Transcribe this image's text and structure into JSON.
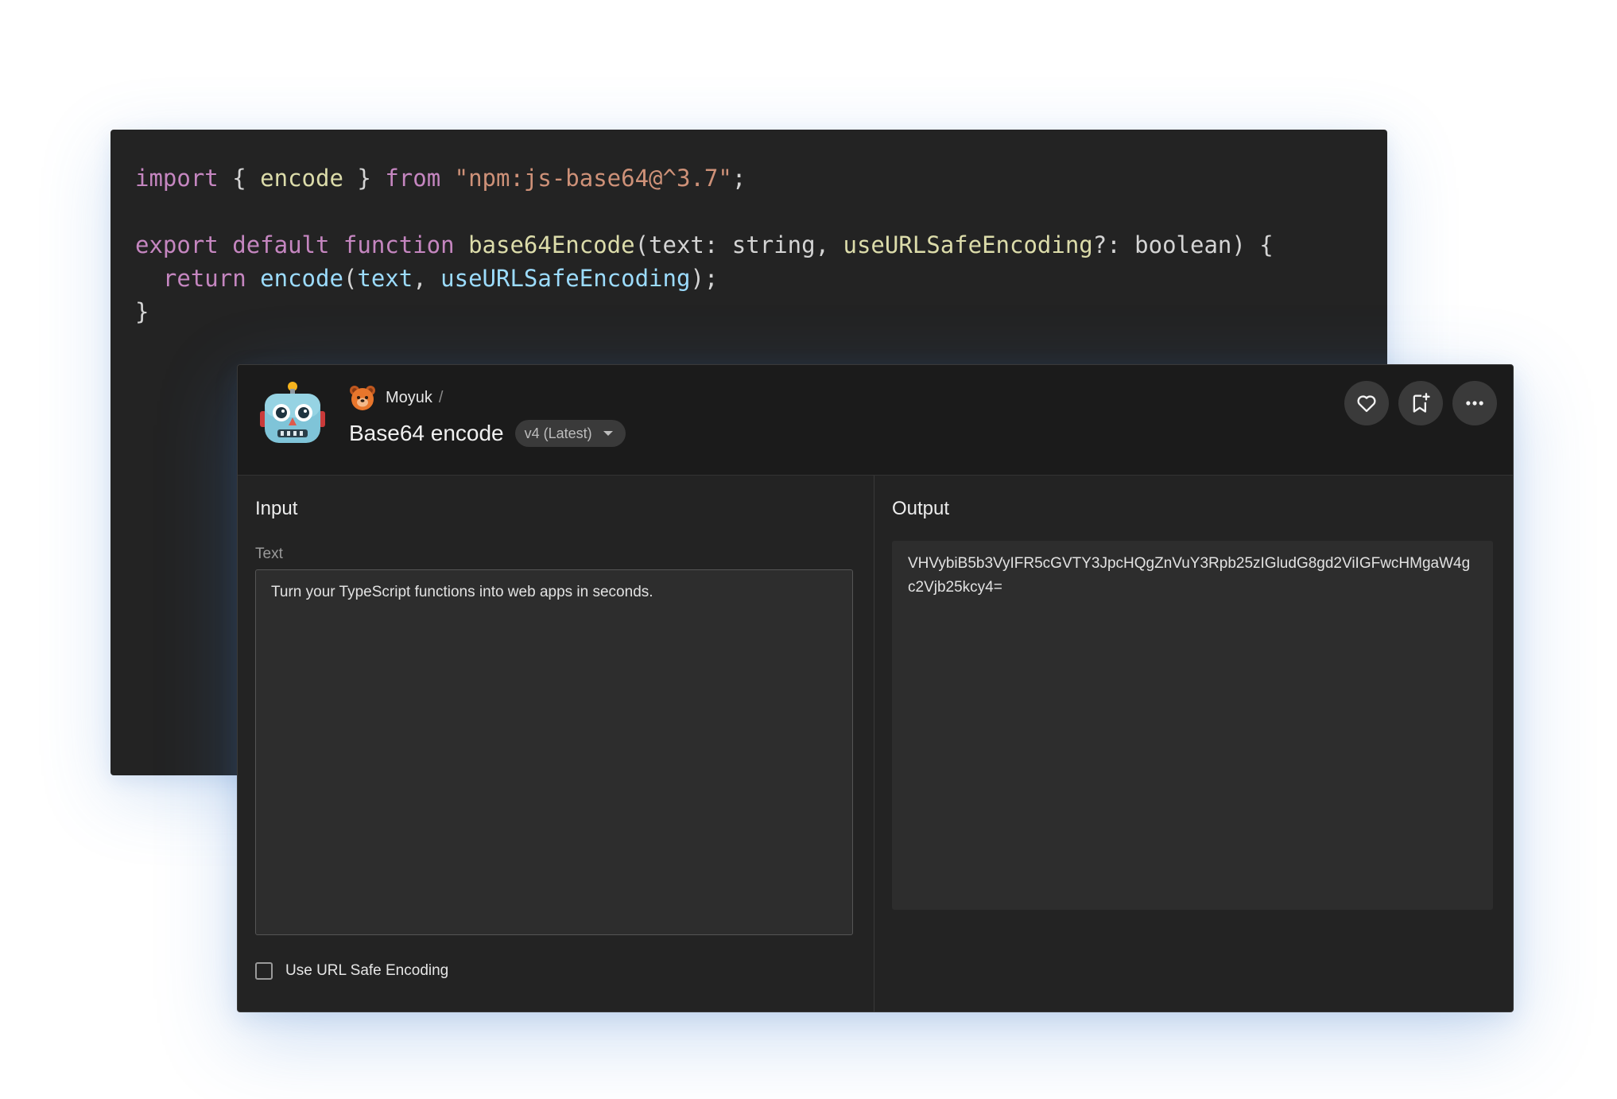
{
  "code": {
    "lines": [
      [
        {
          "t": "import",
          "c": "kw"
        },
        {
          "t": " { ",
          "c": "plain"
        },
        {
          "t": "encode",
          "c": "fn"
        },
        {
          "t": " } ",
          "c": "plain"
        },
        {
          "t": "from",
          "c": "kw"
        },
        {
          "t": " ",
          "c": "plain"
        },
        {
          "t": "\"npm:js-base64@^3.7\"",
          "c": "str"
        },
        {
          "t": ";",
          "c": "plain"
        }
      ],
      [],
      [
        {
          "t": "export",
          "c": "kw"
        },
        {
          "t": " ",
          "c": "plain"
        },
        {
          "t": "default",
          "c": "kw"
        },
        {
          "t": " ",
          "c": "plain"
        },
        {
          "t": "function",
          "c": "kw"
        },
        {
          "t": " ",
          "c": "plain"
        },
        {
          "t": "base64Encode",
          "c": "fn"
        },
        {
          "t": "(text: string, ",
          "c": "plain"
        },
        {
          "t": "useURLSafeEncoding",
          "c": "fn"
        },
        {
          "t": "?: boolean) {",
          "c": "plain"
        }
      ],
      [
        {
          "t": "  ",
          "c": "plain"
        },
        {
          "t": "return",
          "c": "kw"
        },
        {
          "t": " ",
          "c": "plain"
        },
        {
          "t": "encode",
          "c": "var"
        },
        {
          "t": "(",
          "c": "plain"
        },
        {
          "t": "text",
          "c": "var"
        },
        {
          "t": ", ",
          "c": "plain"
        },
        {
          "t": "useURLSafeEncoding",
          "c": "var"
        },
        {
          "t": ");",
          "c": "plain"
        }
      ],
      [
        {
          "t": "}",
          "c": "plain"
        }
      ]
    ]
  },
  "app": {
    "owner": "Moyuk",
    "separator": "/",
    "title": "Base64 encode",
    "version": "v4 (Latest)",
    "actions": {
      "like": "heart-icon",
      "bookmark": "bookmark-add-icon",
      "more": "more-horizontal-icon"
    }
  },
  "input": {
    "title": "Input",
    "text_label": "Text",
    "text_value": "Turn your TypeScript functions into web apps in seconds.",
    "checkbox_label": "Use URL Safe Encoding",
    "checkbox_checked": false
  },
  "output": {
    "title": "Output",
    "value": "VHVybiB5b3VyIFR5cGVTY3JpcHQgZnVuY3Rpb25zIGludG8gd2ViIGFwcHMgaW4gc2Vjb25kcy4="
  },
  "colors": {
    "background": "#ffffff",
    "panel": "#232323",
    "header": "#1b1b1b",
    "keyword": "#c586c0",
    "function": "#dcdcaa",
    "string": "#ce9178",
    "variable": "#9cdcfe"
  }
}
